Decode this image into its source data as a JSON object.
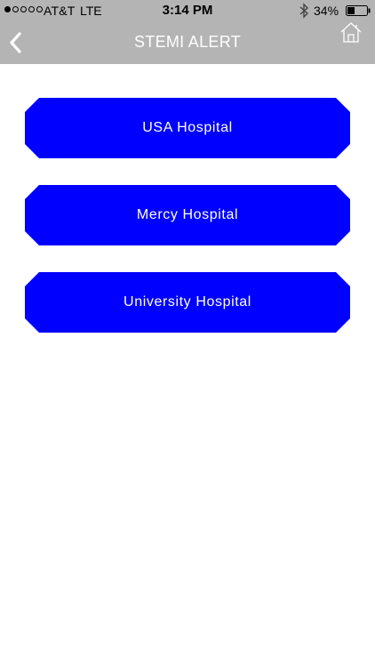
{
  "status_bar": {
    "carrier": "AT&T",
    "network": "LTE",
    "time": "3:14 PM",
    "battery_percent": "34%",
    "battery_level": 0.34,
    "signal_bars_filled": 1,
    "signal_bars_total": 5
  },
  "nav": {
    "title": "STEMI ALERT",
    "back_icon": "chevron-left-icon",
    "home_icon": "home-icon"
  },
  "hospitals": [
    {
      "label": "USA Hospital"
    },
    {
      "label": "Mercy Hospital"
    },
    {
      "label": "University Hospital"
    }
  ],
  "colors": {
    "bar_background": "#b4b4b4",
    "button_blue": "#0000ff",
    "text_white": "#ffffff"
  }
}
